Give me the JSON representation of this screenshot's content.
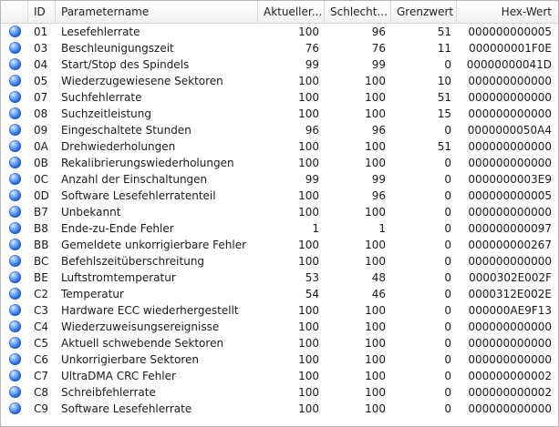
{
  "columns": {
    "id": "ID",
    "name": "Parametername",
    "current": "Aktueller...",
    "worst": "Schlecht...",
    "threshold": "Grenzwert",
    "hex": "Hex-Wert"
  },
  "icon": "status-ok-circle-icon",
  "colors": {
    "status_dot": "#2a6ee8",
    "header_bg": "#f1f1f1",
    "border": "#b7b7b7"
  },
  "rows": [
    {
      "id": "01",
      "name": "Lesefehlerrate",
      "current": "100",
      "worst": "96",
      "threshold": "51",
      "hex": "000000000005"
    },
    {
      "id": "03",
      "name": "Beschleunigungszeit",
      "current": "76",
      "worst": "76",
      "threshold": "11",
      "hex": "000000001F0E"
    },
    {
      "id": "04",
      "name": "Start/Stop des Spindels",
      "current": "99",
      "worst": "99",
      "threshold": "0",
      "hex": "00000000041D"
    },
    {
      "id": "05",
      "name": "Wiederzugewiesene Sektoren",
      "current": "100",
      "worst": "100",
      "threshold": "10",
      "hex": "000000000000"
    },
    {
      "id": "07",
      "name": "Suchfehlerrate",
      "current": "100",
      "worst": "100",
      "threshold": "51",
      "hex": "000000000000"
    },
    {
      "id": "08",
      "name": "Suchzeitleistung",
      "current": "100",
      "worst": "100",
      "threshold": "15",
      "hex": "000000000000"
    },
    {
      "id": "09",
      "name": "Eingeschaltete Stunden",
      "current": "96",
      "worst": "96",
      "threshold": "0",
      "hex": "0000000050A4"
    },
    {
      "id": "0A",
      "name": "Drehwiederholungen",
      "current": "100",
      "worst": "100",
      "threshold": "51",
      "hex": "000000000000"
    },
    {
      "id": "0B",
      "name": "Rekalibrierungswiederholungen",
      "current": "100",
      "worst": "100",
      "threshold": "0",
      "hex": "000000000000"
    },
    {
      "id": "0C",
      "name": "Anzahl der Einschaltungen",
      "current": "99",
      "worst": "99",
      "threshold": "0",
      "hex": "0000000003E9"
    },
    {
      "id": "0D",
      "name": "Software Lesefehlerratenteil",
      "current": "100",
      "worst": "96",
      "threshold": "0",
      "hex": "000000000005"
    },
    {
      "id": "B7",
      "name": "Unbekannt",
      "current": "100",
      "worst": "100",
      "threshold": "0",
      "hex": "000000000000"
    },
    {
      "id": "B8",
      "name": "Ende-zu-Ende Fehler",
      "current": "1",
      "worst": "1",
      "threshold": "0",
      "hex": "000000000097"
    },
    {
      "id": "BB",
      "name": "Gemeldete unkorrigierbare Fehler",
      "current": "100",
      "worst": "100",
      "threshold": "0",
      "hex": "000000000267"
    },
    {
      "id": "BC",
      "name": "Befehlszeitüberschreitung",
      "current": "100",
      "worst": "100",
      "threshold": "0",
      "hex": "000000000000"
    },
    {
      "id": "BE",
      "name": "Luftstromtemperatur",
      "current": "53",
      "worst": "48",
      "threshold": "0",
      "hex": "0000302E002F"
    },
    {
      "id": "C2",
      "name": "Temperatur",
      "current": "54",
      "worst": "46",
      "threshold": "0",
      "hex": "0000312E002E"
    },
    {
      "id": "C3",
      "name": "Hardware ECC wiederhergestellt",
      "current": "100",
      "worst": "100",
      "threshold": "0",
      "hex": "000000AE9F13"
    },
    {
      "id": "C4",
      "name": "Wiederzuweisungsereignisse",
      "current": "100",
      "worst": "100",
      "threshold": "0",
      "hex": "000000000000"
    },
    {
      "id": "C5",
      "name": "Aktuell schwebende Sektoren",
      "current": "100",
      "worst": "100",
      "threshold": "0",
      "hex": "000000000000"
    },
    {
      "id": "C6",
      "name": "Unkorrigierbare Sektoren",
      "current": "100",
      "worst": "100",
      "threshold": "0",
      "hex": "000000000000"
    },
    {
      "id": "C7",
      "name": "UltraDMA CRC Fehler",
      "current": "100",
      "worst": "100",
      "threshold": "0",
      "hex": "000000000002"
    },
    {
      "id": "C8",
      "name": "Schreibfehlerrate",
      "current": "100",
      "worst": "100",
      "threshold": "0",
      "hex": "000000000002"
    },
    {
      "id": "C9",
      "name": "Software Lesefehlerrate",
      "current": "100",
      "worst": "100",
      "threshold": "0",
      "hex": "000000000000"
    }
  ]
}
